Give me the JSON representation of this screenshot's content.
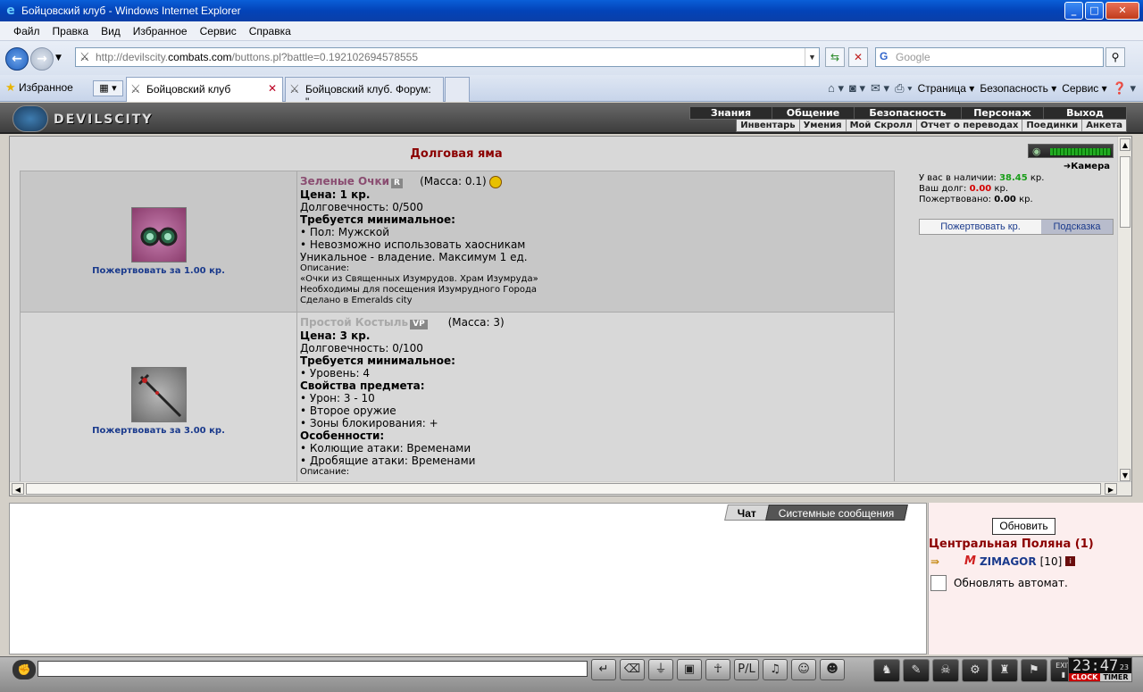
{
  "window": {
    "title": "Бойцовский клуб - Windows Internet Explorer"
  },
  "menu": [
    "Файл",
    "Правка",
    "Вид",
    "Избранное",
    "Сервис",
    "Справка"
  ],
  "address": {
    "prefix": "http://devilscity.",
    "domain": "combats.com",
    "path": "/buttons.pl?battle=0.192102694578555"
  },
  "search": {
    "placeholder": "Google"
  },
  "favorites_label": "Избранное",
  "tabs": [
    {
      "label": "Бойцовский клуб",
      "active": true
    },
    {
      "label": "Бойцовский клуб. Форум: \"...",
      "active": false
    }
  ],
  "ie_tools": {
    "page": "Страница",
    "security": "Безопасность",
    "service": "Сервис"
  },
  "game_logo": "DEVILSCITY",
  "top_nav": [
    "Знания",
    "Общение",
    "Безопасность",
    "Персонаж",
    "Выход"
  ],
  "sub_nav": [
    "Инвентарь",
    "Умения",
    "Мой Скролл",
    "Отчет о переводах",
    "Поединки",
    "Анкета"
  ],
  "page_title": "Долговая яма",
  "items": [
    {
      "name": "Зеленые Очки",
      "badge": "R",
      "mass": "(Масса: 0.1)",
      "donate": "Пожертвовать за 1.00 кр.",
      "price": "Цена: 1 кр.",
      "durability": "Долговечность: 0/500",
      "req_header": "Требуется минимальное:",
      "req_lines": [
        "• Пол: Мужской",
        "• Невозможно использовать хаосникам"
      ],
      "unique": "Уникальное - владение. Максимум 1 ед.",
      "desc_header": "Описание:",
      "desc_lines": [
        "«Очки из Священных Изумрудов. Храм Изумруда»",
        "Необходимы для посещения Изумрудного Города"
      ],
      "made": "Сделано в Emeralds city"
    },
    {
      "name": "Простой Костыль",
      "badge": "VP",
      "mass": "(Масса: 3)",
      "donate": "Пожертвовать за 3.00 кр.",
      "price": "Цена: 3 кр.",
      "durability": "Долговечность: 0/100",
      "req_header": "Требуется минимальное:",
      "req_lines": [
        "• Уровень: 4"
      ],
      "props_header": "Свойства предмета:",
      "props_lines": [
        "• Урон: 3 - 10",
        "• Второе оружие",
        "• Зоны блокирования: +"
      ],
      "features_header": "Особенности:",
      "features_lines": [
        "• Колющие атаки: Временами",
        "• Дробящие атаки: Временами"
      ],
      "desc_header": "Описание:"
    }
  ],
  "right_panel": {
    "camera_label": "Камера",
    "have_label": "У вас в наличии:",
    "have_value": "38.45",
    "debt_label": "Ваш долг:",
    "debt_value": "0.00",
    "donated_label": "Пожертвовано:",
    "donated_value": "0.00",
    "currency": "кр.",
    "tab_donate": "Пожертвовать кр.",
    "tab_hint": "Подсказка"
  },
  "chat": {
    "tab_chat": "Чат",
    "tab_system": "Системные сообщения"
  },
  "users": {
    "refresh": "Обновить",
    "location": "Центральная Поляна (1)",
    "user_nick": "ZIMAGOR",
    "user_level": "[10]",
    "auto_update": "Обновлять автомат."
  },
  "clock": {
    "time": "23:47",
    "seconds": "23",
    "clock_label": "CLOCK",
    "timer_label": "TIMER",
    "exit_label": "EXIT"
  },
  "colors": {
    "accent_red": "#8b0000",
    "link_blue": "#1a3a8c",
    "money_green": "#1a9e1a",
    "debt_red": "#d40000"
  }
}
